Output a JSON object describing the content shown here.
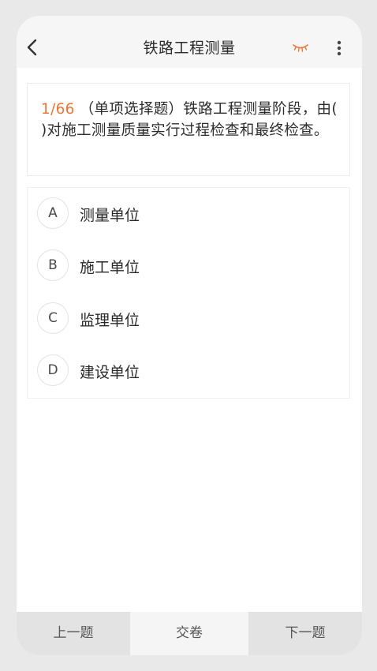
{
  "header": {
    "title": "铁路工程测量"
  },
  "question": {
    "number": "1/66",
    "text": "（单项选择题）铁路工程测量阶段，由( )对施工测量质量实行过程检查和最终检查。"
  },
  "options": [
    {
      "letter": "A",
      "label": "测量单位"
    },
    {
      "letter": "B",
      "label": "施工单位"
    },
    {
      "letter": "C",
      "label": "监理单位"
    },
    {
      "letter": "D",
      "label": "建设单位"
    }
  ],
  "footer": {
    "prev_label": "上一题",
    "submit_label": "交卷",
    "next_label": "下一题"
  },
  "colors": {
    "accent": "#e8763a"
  }
}
